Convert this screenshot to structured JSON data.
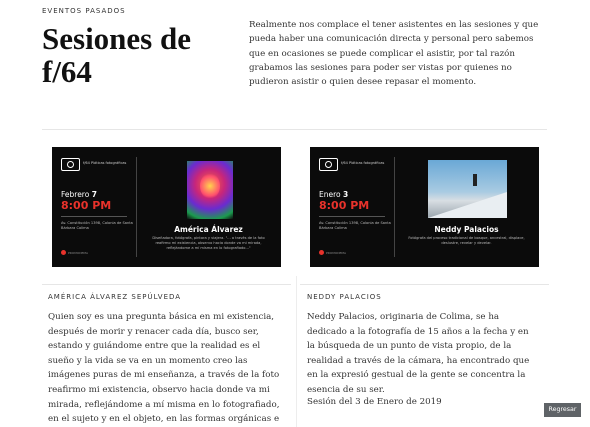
{
  "header": {
    "eyebrow": "EVENTOS PASADOS",
    "title": "Sesiones de f/64",
    "intro": "Realmente nos complace el tener asistentes en las sesiones y que pueda haber una comunicación directa y personal pero sabemos que en ocasiones se puede complicar el asistir, por tal razón grabamos las sesiones para poder ser vistas por quienes no pudieron asistir o quien desee repasar el momento."
  },
  "events": [
    {
      "logo_text": "f/64  Pláticas fotográficas",
      "month": "Febrero",
      "day": "7",
      "time": "8:00 PM",
      "venue": "Av. Constitución 1398, Colonia de Santa Bárbara Colima",
      "brand": "PROMODEMA",
      "speaker": "América Álvarez",
      "speaker_desc": "Diseñadora, fotógrafa, pintora y viajera. \"... a través de la foto reafirmo mi existencia, observo hacia donde va mi mirada, reflejándome a mí misma en lo fotografiado...\"",
      "heading": "AMÉRICA ÁLVAREZ SEPÚLVEDA",
      "bio": "Quien soy es una pregunta básica en mi existencia, después de morir y renacer cada día, busco ser, estando y guiándome entre que la realidad es el sueño y la vida se va en un momento creo las imágenes puras de mi enseñanza, a través de la foto reafirmo mi existencia, observo hacia donde va mi mirada, reflejándome a mí misma en lo fotografiado, en el sujeto y en el objeto, en las formas orgánicas e"
    },
    {
      "logo_text": "f/64  Pláticas fotográficas",
      "month": "Enero",
      "day": "3",
      "time": "8:00 PM",
      "venue": "Av. Constitución 1398, Colonia de Santa Bárbara Colima",
      "brand": "PROMODEMA",
      "speaker": "Neddy Palacios",
      "speaker_desc": "Fotógrafa del proceso tradicional de bosque, ancestral, displace, deslustre, revelar y develar.",
      "heading": "NEDDY PALACIOS",
      "bio": "Neddy Palacios, originaria de Colima, se ha dedicado a la fotografía de 15 años a la fecha y en la búsqueda de un punto de vista propio, de la realidad a través de la cámara, ha encontrado que en la expresió gestual de la gente se concentra la esencia de su ser.",
      "session": "Sesión del 3 de Enero de 2019"
    }
  ],
  "back_button": "Regresar",
  "colors": {
    "accent": "#e8322b",
    "card_bg": "#0b0b0b",
    "button_bg": "#5f6367"
  }
}
